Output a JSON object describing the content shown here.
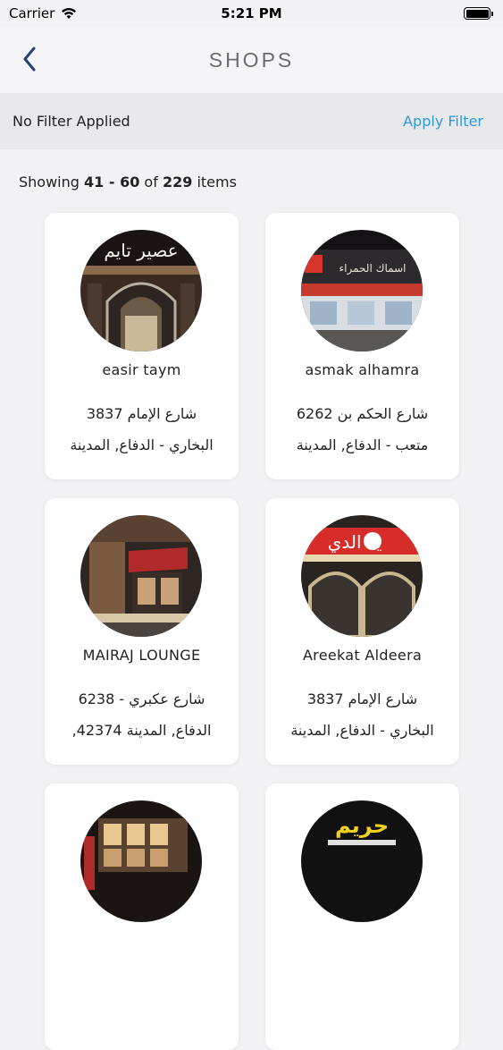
{
  "status_bar": {
    "carrier": "Carrier",
    "time": "5:21 PM"
  },
  "nav": {
    "title": "SHOPS",
    "back_icon": "chevron-left-icon"
  },
  "filter": {
    "status": "No Filter Applied",
    "apply_label": "Apply Filter"
  },
  "results": {
    "prefix": "Showing",
    "range": "41 - 60",
    "of": "of",
    "total": "229",
    "suffix": "items"
  },
  "colors": {
    "accent": "#2e9ad4",
    "background": "#f2f2f4",
    "card": "#ffffff"
  },
  "shops": [
    {
      "name": "easir taym",
      "address_line1": "شارع الإمام 3837",
      "address_line2": "البخاري - الدفاع, المدينة",
      "photo_label": "عصير تايم"
    },
    {
      "name": "asmak alhamra",
      "address_line1": "شارع الحكم بن 6262",
      "address_line2": "متعب - الدفاع, المدينة",
      "photo_label": "اسماك الحمراء"
    },
    {
      "name": "MAIRAJ LOUNGE",
      "address_line1": "شارع عكبري - 6238",
      "address_line2": "الدفاع, المدينة 42374,",
      "photo_label": ""
    },
    {
      "name": "Areekat Aldeera",
      "address_line1": "شارع الإمام 3837",
      "address_line2": "البخاري - الدفاع, المدينة",
      "photo_label": "ية الدي"
    },
    {
      "name": "",
      "address_line1": "",
      "address_line2": "",
      "photo_label": ""
    },
    {
      "name": "",
      "address_line1": "",
      "address_line2": "",
      "photo_label": "حريم"
    }
  ]
}
